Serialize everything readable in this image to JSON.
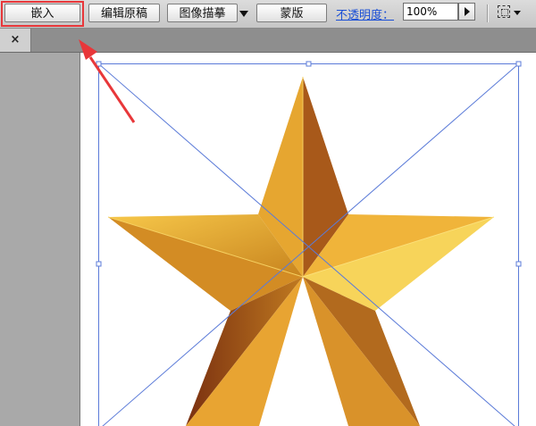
{
  "toolbar": {
    "embed_label": "嵌入",
    "edit_original_label": "编辑原稿",
    "image_trace_label": "图像描摹",
    "mask_label": "蒙版",
    "opacity_label": "不透明度：",
    "opacity_value": "100%"
  },
  "tab": {
    "close_symbol": "×"
  },
  "colors": {
    "highlight": "#e8373a",
    "arrow": "#e8373a",
    "selection_line": "#5b7bd8",
    "star_light": "#f7c84a",
    "star_mid": "#d99a26",
    "star_dark": "#8a3c12"
  },
  "icons": [
    "dropdown-arrow-icon",
    "stepper-arrow-icon",
    "selection-options-icon",
    "close-icon"
  ]
}
